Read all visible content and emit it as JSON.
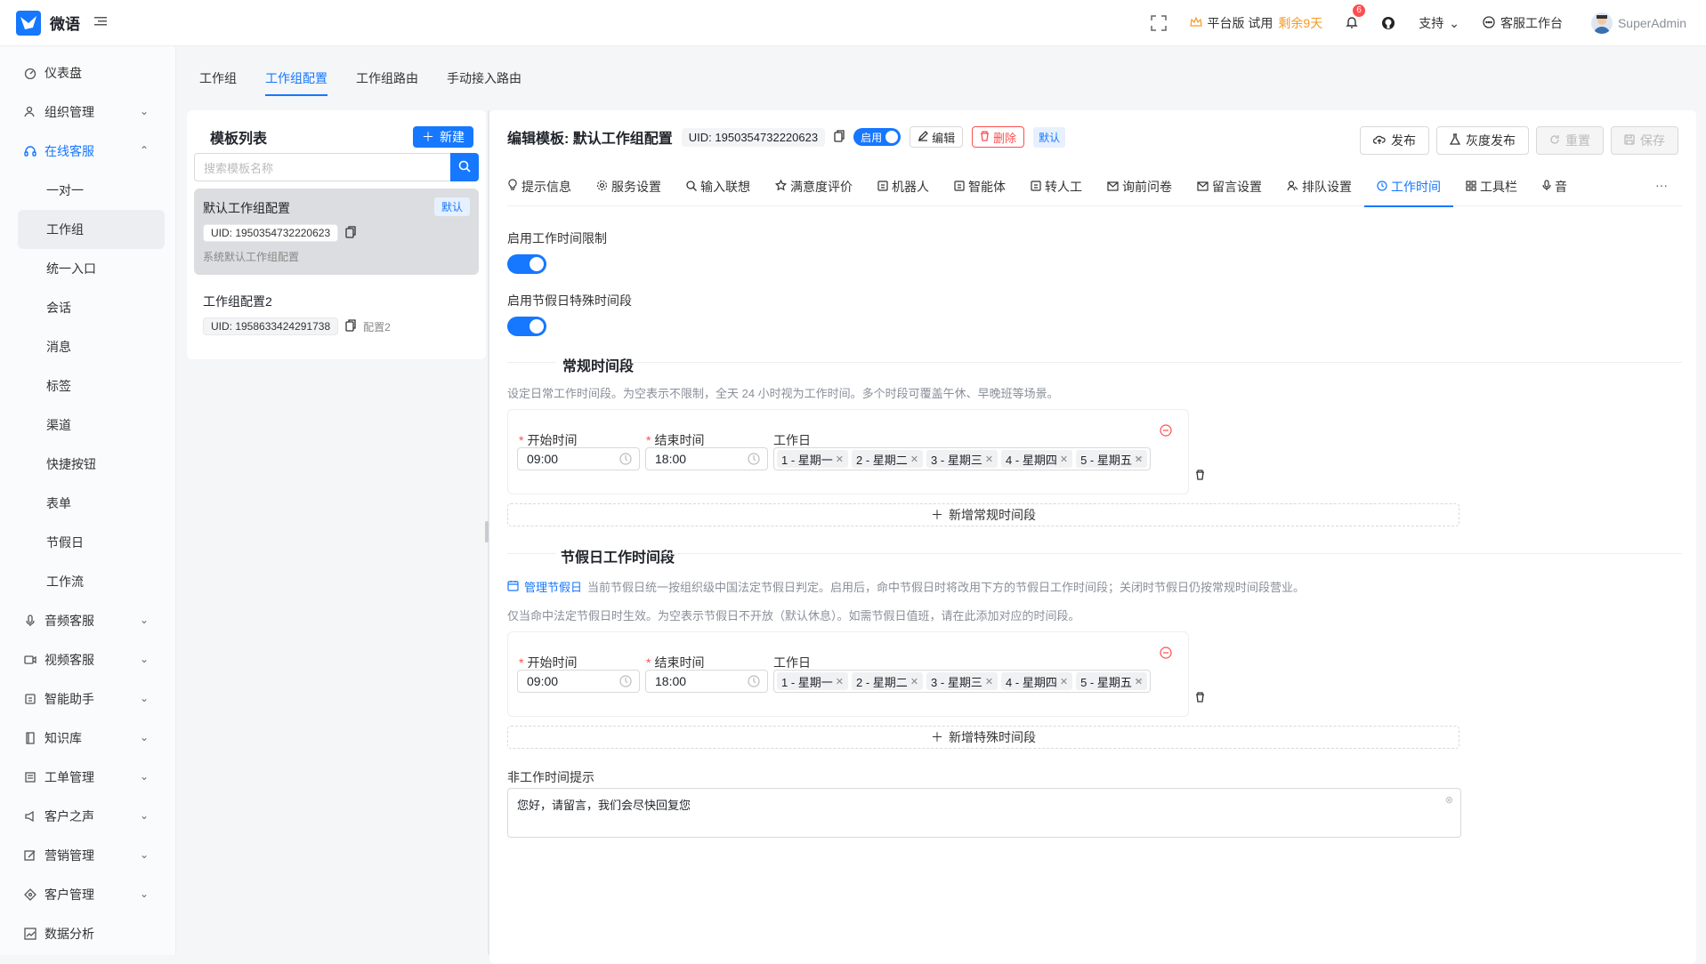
{
  "app": {
    "name": "微语",
    "brand_color": "#1677ff"
  },
  "topbar": {
    "plan_label": "平台版 试用",
    "plan_remaining": "剩余9天",
    "notification_count": "6",
    "support_label": "支持",
    "workbench_label": "客服工作台",
    "username": "SuperAdmin"
  },
  "sidebar": {
    "items": [
      {
        "label": "仪表盘",
        "icon": "dashboard-icon"
      },
      {
        "label": "组织管理",
        "icon": "org-icon",
        "chevron": true
      },
      {
        "label": "在线客服",
        "icon": "headset-icon",
        "chevron": true,
        "open": true
      },
      {
        "label": "音频客服",
        "icon": "mic-icon",
        "chevron": true
      },
      {
        "label": "视频客服",
        "icon": "video-icon",
        "chevron": true
      },
      {
        "label": "智能助手",
        "icon": "assistant-icon",
        "chevron": true
      },
      {
        "label": "知识库",
        "icon": "book-icon",
        "chevron": true
      },
      {
        "label": "工单管理",
        "icon": "ticket-icon",
        "chevron": true
      },
      {
        "label": "客户之声",
        "icon": "voice-icon",
        "chevron": true
      },
      {
        "label": "营销管理",
        "icon": "marketing-icon",
        "chevron": true
      },
      {
        "label": "客户管理",
        "icon": "customer-icon",
        "chevron": true
      },
      {
        "label": "数据分析",
        "icon": "chart-icon"
      }
    ],
    "sub_items": [
      "一对一",
      "工作组",
      "统一入口",
      "会话",
      "消息",
      "标签",
      "渠道",
      "快捷按钮",
      "表单",
      "节假日",
      "工作流"
    ],
    "active_sub": "工作组"
  },
  "top_tabs": [
    "工作组",
    "工作组配置",
    "工作组路由",
    "手动接入路由"
  ],
  "active_top_tab": "工作组配置",
  "template_list": {
    "title": "模板列表",
    "new_button": "新建",
    "search_placeholder": "搜索模板名称",
    "items": [
      {
        "name": "默认工作组配置",
        "uid": "UID: 1950354732220623",
        "desc": "系统默认工作组配置",
        "badge": "默认"
      },
      {
        "name": "工作组配置2",
        "uid": "UID: 1958633424291738",
        "note": "配置2"
      }
    ]
  },
  "editor": {
    "title": "编辑模板: 默认工作组配置",
    "uid": "UID: 1950354732220623",
    "enabled_label": "启用",
    "edit_label": "编辑",
    "delete_label": "删除",
    "default_tag": "默认",
    "actions": {
      "publish": "发布",
      "gray_publish": "灰度发布",
      "reset": "重置",
      "save": "保存"
    },
    "tabs": [
      {
        "label": "提示信息",
        "icon": "bulb-icon"
      },
      {
        "label": "服务设置",
        "icon": "gear-icon"
      },
      {
        "label": "输入联想",
        "icon": "search-icon"
      },
      {
        "label": "满意度评价",
        "icon": "star-icon"
      },
      {
        "label": "机器人",
        "icon": "robot-icon"
      },
      {
        "label": "智能体",
        "icon": "agent-icon"
      },
      {
        "label": "转人工",
        "icon": "transfer-icon"
      },
      {
        "label": "询前问卷",
        "icon": "mail-icon"
      },
      {
        "label": "留言设置",
        "icon": "message-icon"
      },
      {
        "label": "排队设置",
        "icon": "queue-icon"
      },
      {
        "label": "工作时间",
        "icon": "clock-icon",
        "active": true
      },
      {
        "label": "工具栏",
        "icon": "grid-icon"
      },
      {
        "label": "音视",
        "icon": "mic-icon"
      }
    ]
  },
  "work_time": {
    "enable_limit_label": "启用工作时间限制",
    "enable_limit": true,
    "enable_holiday_label": "启用节假日特殊时间段",
    "enable_holiday": true,
    "regular": {
      "title": "常规时间段",
      "hint": "设定日常工作时间段。为空表示不限制，全天 24 小时视为工作时间。多个时段可覆盖午休、早晚班等场景。",
      "start_label": "开始时间",
      "end_label": "结束时间",
      "days_label": "工作日",
      "start": "09:00",
      "end": "18:00",
      "days": [
        "1 - 星期一",
        "2 - 星期二",
        "3 - 星期三",
        "4 - 星期四",
        "5 - 星期五"
      ],
      "add_label": "新增常规时间段"
    },
    "holiday": {
      "title": "节假日工作时间段",
      "manage_link": "管理节假日",
      "hint1": "当前节假日统一按组织级中国法定节假日判定。启用后，命中节假日时将改用下方的节假日工作时间段；关闭时节假日仍按常规时间段营业。",
      "hint2": "仅当命中法定节假日时生效。为空表示节假日不开放（默认休息）。如需节假日值班，请在此添加对应的时间段。",
      "start_label": "开始时间",
      "end_label": "结束时间",
      "days_label": "工作日",
      "start": "09:00",
      "end": "18:00",
      "days": [
        "1 - 星期一",
        "2 - 星期二",
        "3 - 星期三",
        "4 - 星期四",
        "5 - 星期五"
      ],
      "add_label": "新增特殊时间段"
    },
    "offhours_label": "非工作时间提示",
    "offhours_text": "您好，请留言，我们会尽快回复您"
  }
}
